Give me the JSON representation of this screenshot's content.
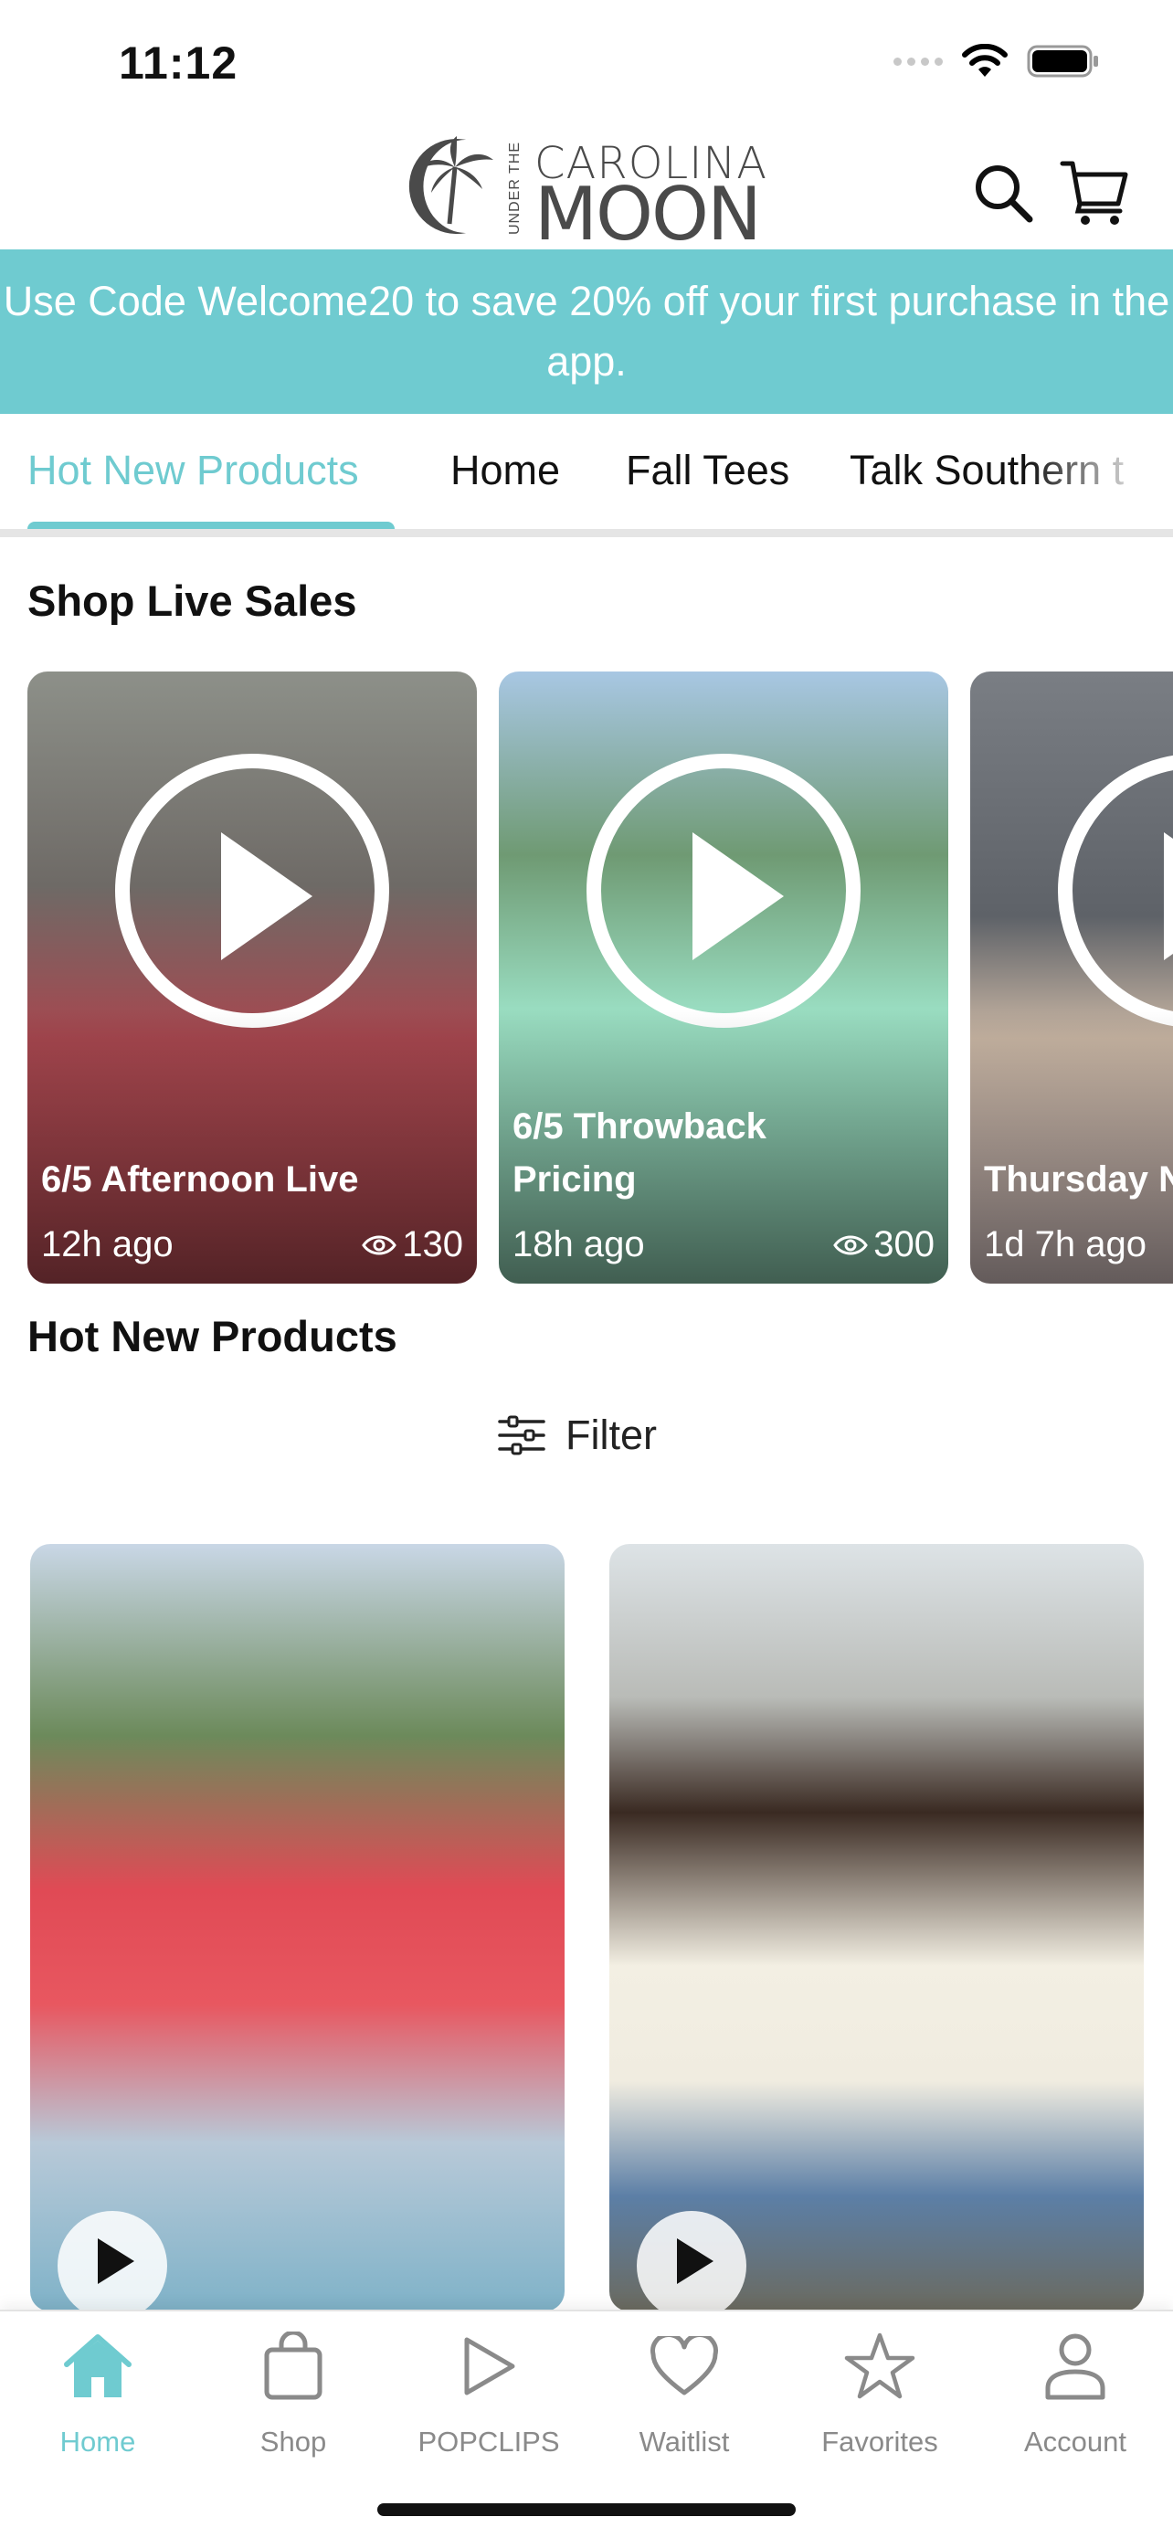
{
  "status_bar": {
    "time": "11:12"
  },
  "header": {
    "logo": {
      "small": "UNDER THE",
      "top": "CAROLINA",
      "bottom": "MOON"
    },
    "search_icon": "search-icon",
    "cart_icon": "cart-icon"
  },
  "promo": {
    "text": "Use Code Welcome20 to save 20% off your first purchase in the app."
  },
  "tabs": [
    {
      "label": "Hot New Products",
      "active": true
    },
    {
      "label": "Home",
      "active": false
    },
    {
      "label": "Fall Tees",
      "active": false
    },
    {
      "label": "Talk Southern t",
      "active": false
    }
  ],
  "live_sales": {
    "title": "Shop Live Sales",
    "cards": [
      {
        "title": "6/5 Afternoon Live",
        "ago": "12h ago",
        "views": "130"
      },
      {
        "title": "6/5 Throwback Pricing",
        "ago": "18h ago",
        "views": "300"
      },
      {
        "title": "Thursday N",
        "ago": "1d 7h ago",
        "views": ""
      }
    ]
  },
  "hot_new": {
    "title": "Hot New Products",
    "filter_label": "Filter"
  },
  "colors": {
    "accent": "#6fcbd0",
    "banner": "#6fcbd0",
    "inactive": "#8a8a8a"
  },
  "bottom_nav": [
    {
      "label": "Home",
      "icon": "home-icon",
      "active": true
    },
    {
      "label": "Shop",
      "icon": "shopping-bag-icon",
      "active": false
    },
    {
      "label": "POPCLIPS",
      "icon": "play-outline-icon",
      "active": false
    },
    {
      "label": "Waitlist",
      "icon": "heart-icon",
      "active": false
    },
    {
      "label": "Favorites",
      "icon": "star-icon",
      "active": false
    },
    {
      "label": "Account",
      "icon": "person-icon",
      "active": false
    }
  ]
}
